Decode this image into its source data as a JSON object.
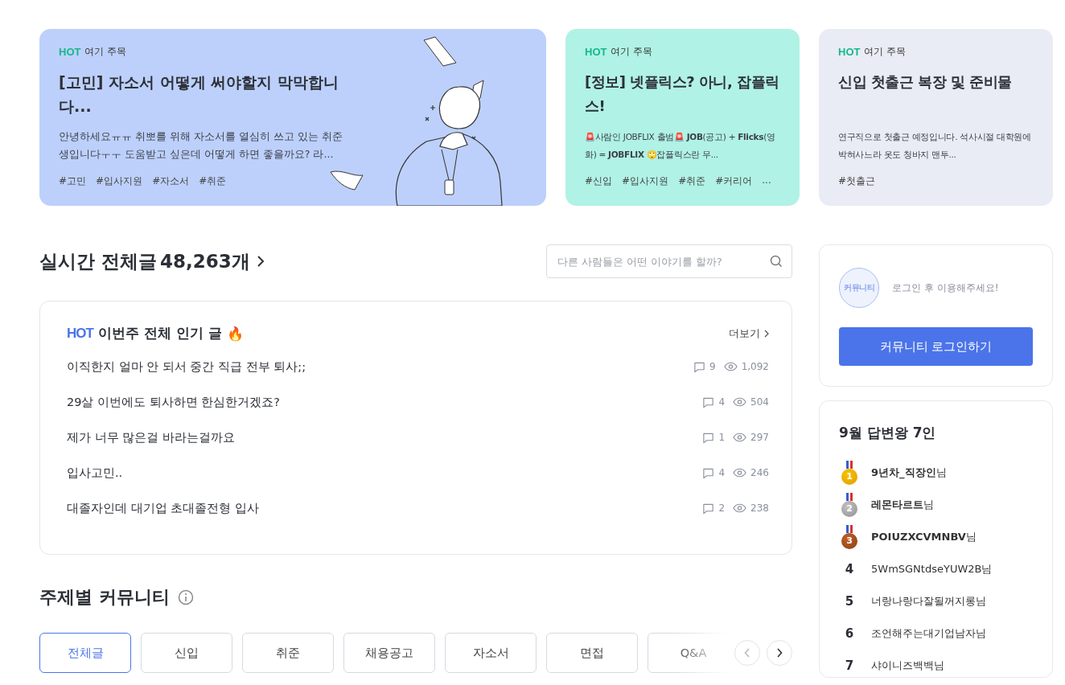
{
  "featured": [
    {
      "badge": "HOT",
      "label": "여기 주목",
      "title": "[고민] 자소서 어떻게 써야할지 막막합니다...",
      "body": "안녕하세요ㅠㅠ 취뽀를 위해 자소서를 열심히 쓰고 있는 취준생입니다ㅜㅜ 도움받고 싶은데 어떻게 하면 좋을까요? 라...",
      "tags": [
        "#고민",
        "#입사지원",
        "#자소서",
        "#취준"
      ],
      "color": "#bdd0fb",
      "kind": "wide"
    },
    {
      "badge": "HOT",
      "label": "여기 주목",
      "title": "[정보] 넷플릭스? 아니, 잡플릭스!",
      "body": "🚨사람인 JOBFLIX 출범🚨 **JOB**(공고) + **Flicks**(영화) = **JOBFLIX**  🙄잡플릭스란 무...",
      "tags": [
        "#신입",
        "#입사지원",
        "#취준",
        "#커리어",
        "..."
      ],
      "color": "#b0f2e5",
      "kind": "narrow"
    },
    {
      "badge": "HOT",
      "label": "여기 주목",
      "title": "신입 첫출근 복장 및 준비물",
      "body": "연구직으로 첫출근 예정입니다. 석사시절 대학원에 박혀사느라 옷도 청바지 맨투...",
      "tags": [
        "#첫출근"
      ],
      "color": "#e9ecf4",
      "kind": "narrow"
    }
  ],
  "realtime": {
    "title": "실시간 전체글",
    "count": "48,263개",
    "search": {
      "placeholder": "다른 사람들은 어떤 이야기를 할까?"
    }
  },
  "hot": {
    "badge": "HOT",
    "title": "이번주 전체 인기 글",
    "emoji": "🔥",
    "more": "더보기",
    "posts": [
      {
        "title": "이직한지 얼마 안 되서 중간 직급 전부 퇴사;;",
        "comments": "9",
        "views": "1,092"
      },
      {
        "title": "29살 이번에도 퇴사하면 한심한거겠죠?",
        "comments": "4",
        "views": "504"
      },
      {
        "title": "제가 너무 많은걸 바라는걸까요",
        "comments": "1",
        "views": "297"
      },
      {
        "title": "입사고민..",
        "comments": "4",
        "views": "246"
      },
      {
        "title": "대졸자인데 대기업 초대졸전형 입사",
        "comments": "2",
        "views": "238"
      }
    ]
  },
  "topics": {
    "title": "주제별 커뮤니티",
    "tabs": [
      {
        "label": "전체글",
        "selected": true
      },
      {
        "label": "신입",
        "selected": false
      },
      {
        "label": "취준",
        "selected": false
      },
      {
        "label": "채용공고",
        "selected": false
      },
      {
        "label": "자소서",
        "selected": false
      },
      {
        "label": "면접",
        "selected": false
      },
      {
        "label": "Q&A",
        "selected": false
      }
    ],
    "prev_disabled": true,
    "next_disabled": false
  },
  "login": {
    "avatar": "커뮤니티",
    "message": "로그인 후 이용해주세요!",
    "button": "커뮤니티 로그인하기"
  },
  "ranking": {
    "title": "9월 답변왕 7인",
    "items": [
      {
        "rank": "1",
        "kind": "gold",
        "name": "9년차_직장인",
        "suffix": "님"
      },
      {
        "rank": "2",
        "kind": "silver",
        "name": "레몬타르트",
        "suffix": "님"
      },
      {
        "rank": "3",
        "kind": "bronze",
        "name": "POIUZXCVMNBV",
        "suffix": "님"
      },
      {
        "rank": "4",
        "kind": "plain",
        "name": "5WmSGNtdseYUW2B",
        "suffix": "님"
      },
      {
        "rank": "5",
        "kind": "plain",
        "name": "너랑나랑다잘될꺼지롱",
        "suffix": "님"
      },
      {
        "rank": "6",
        "kind": "plain",
        "name": "조언해주는대기업남자",
        "suffix": "님"
      },
      {
        "rank": "7",
        "kind": "plain",
        "name": "샤이니즈백백",
        "suffix": "님"
      }
    ]
  }
}
